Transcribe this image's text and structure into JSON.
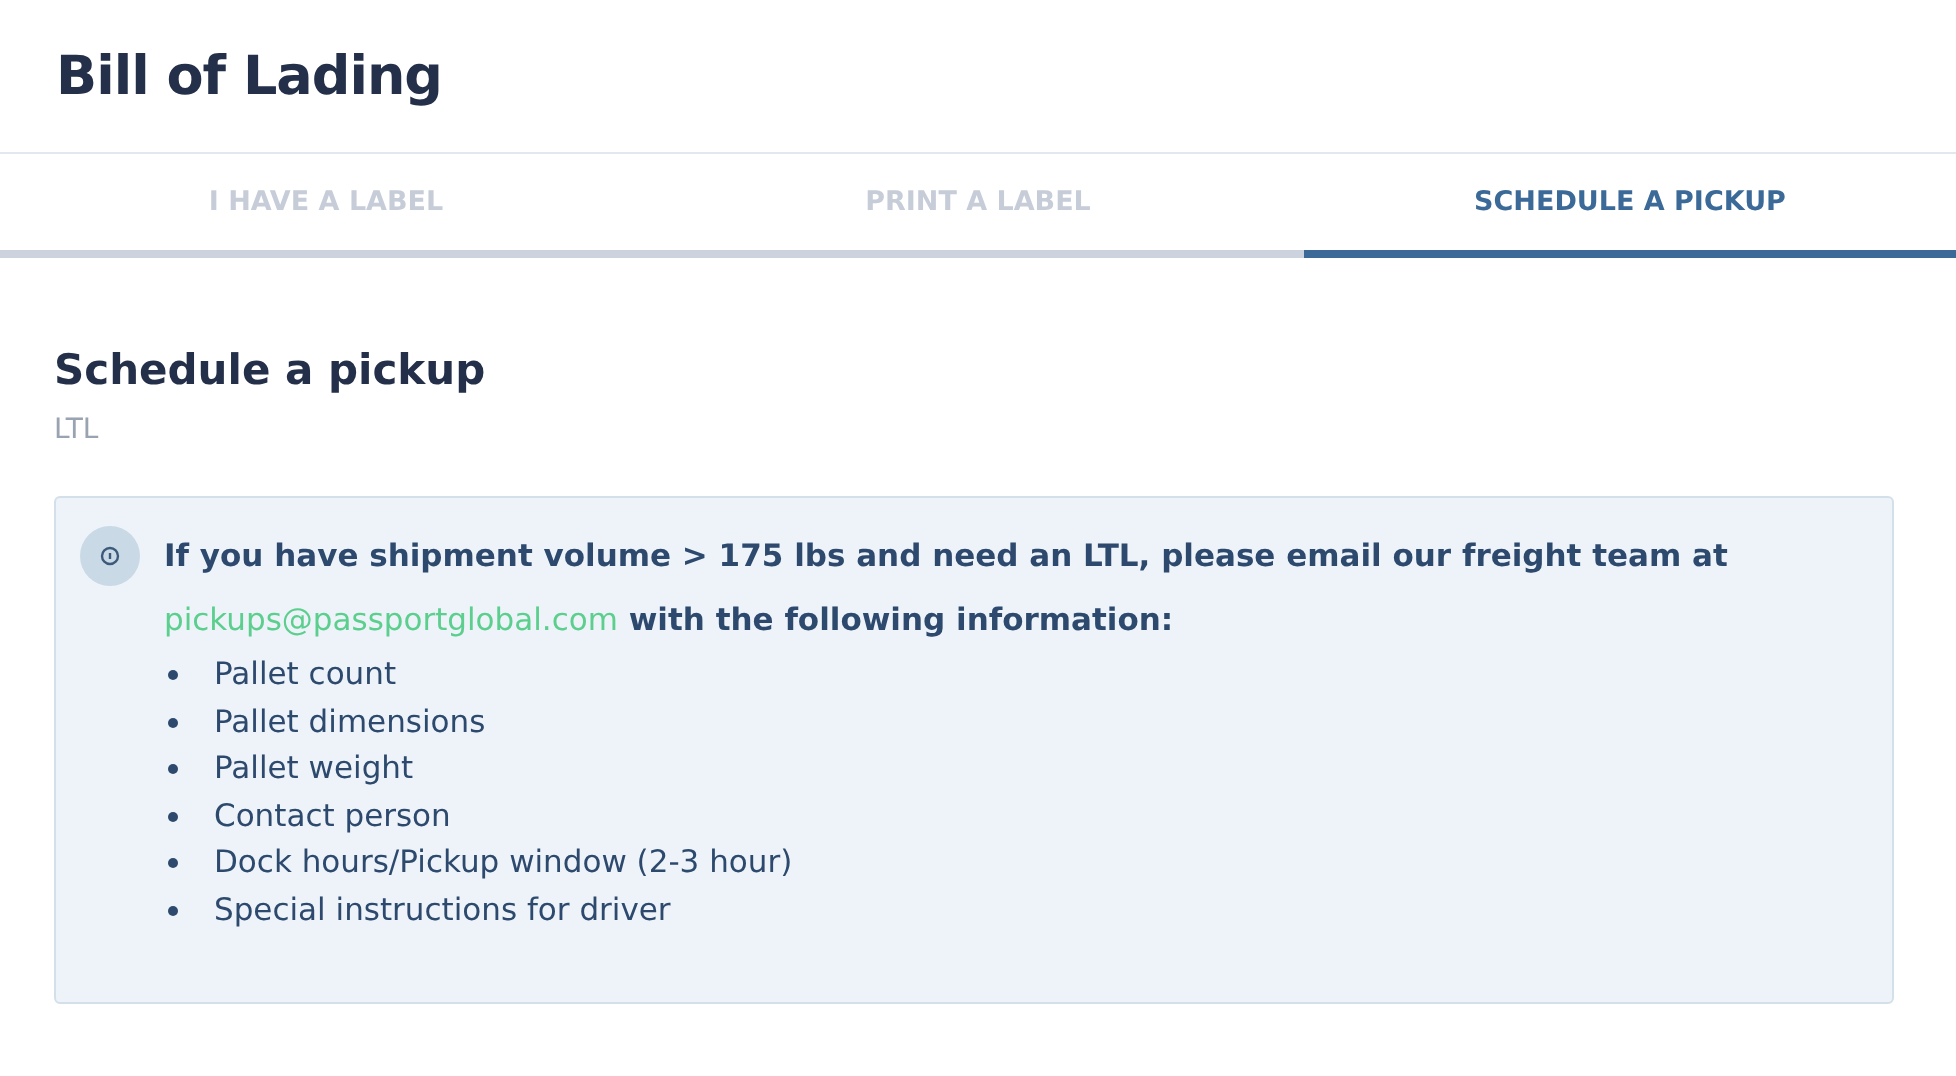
{
  "page_title": "Bill of Lading",
  "tabs": [
    {
      "label": "I HAVE A LABEL",
      "selected": false
    },
    {
      "label": "PRINT A LABEL",
      "selected": false
    },
    {
      "label": "SCHEDULE A PICKUP",
      "selected": true
    }
  ],
  "section": {
    "heading": "Schedule a pickup",
    "subtitle": "LTL"
  },
  "notice": {
    "text_before": "If you have shipment volume > 175 lbs and need an LTL, please email our freight team at ",
    "link": "pickups@passportglobal.com",
    "text_after": " with the following information:",
    "items": [
      "Pallet count",
      "Pallet dimensions",
      "Pallet weight",
      "Contact person",
      "Dock hours/Pickup window (2-3 hour)",
      "Special instructions for driver"
    ]
  }
}
